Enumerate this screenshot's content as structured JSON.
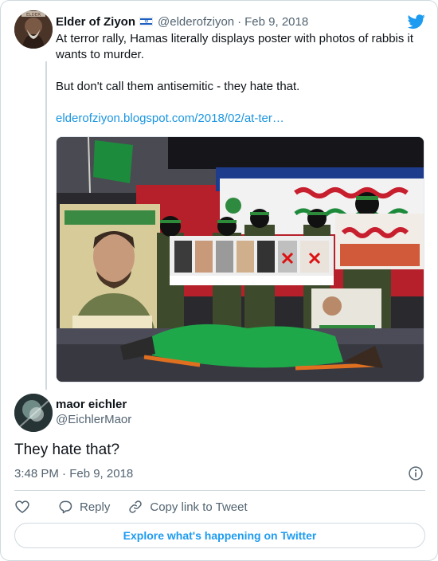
{
  "parent_tweet": {
    "author_name": "Elder of Ziyon",
    "flag_icon": "israel-flag-icon",
    "handle": "@elderofziyon",
    "separator": "·",
    "date": "Feb 9, 2018",
    "text_line_1": "At terror rally, Hamas literally displays poster with photos of rabbis it wants to murder.",
    "text_line_2": "But don't call them antisemitic - they hate that.",
    "link": "elderofziyon.blogspot.com/2018/02/at-ter…",
    "logo_icon": "twitter-bird-icon",
    "avatar_badge": "ELDER"
  },
  "reply_tweet": {
    "author_name": "maor eichler",
    "handle": "@EichlerMaor",
    "text": "They hate that?",
    "timestamp": "3:48 PM · Feb 9, 2018"
  },
  "actions": {
    "reply_label": "Reply",
    "copy_label": "Copy link to Tweet"
  },
  "explore_label": "Explore what's happening on Twitter",
  "colors": {
    "accent": "#1d9bf0",
    "link": "#1b95e0",
    "secondary_text": "#536471",
    "border": "#cfd9de"
  }
}
